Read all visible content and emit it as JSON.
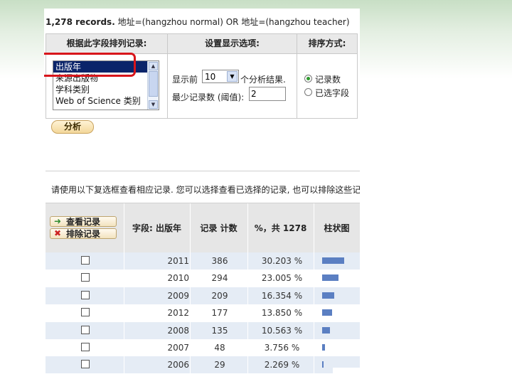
{
  "records_summary": {
    "count": "1,278 records.",
    "query": "地址=(hangzhou normal) OR 地址=(hangzhou teacher)"
  },
  "panel": {
    "col1_header": "根据此字段排列记录:",
    "col2_header": "设置显示选项:",
    "col3_header": "排序方式:",
    "field_list": [
      "出版年",
      "来源出版物",
      "学科类别",
      "Web of Science 类别"
    ],
    "selected_field": "出版年",
    "show_prefix": "显示前",
    "show_count": "10",
    "show_suffix": "个分析结果.",
    "min_records_label": "最少记录数 (阈值):",
    "min_records_value": "2",
    "sort_options": [
      "记录数",
      "已选字段"
    ],
    "sort_selected": "记录数"
  },
  "analyze_button": "分析",
  "info_text": "请使用以下复选框查看相应记录. 您可以选择查看已选择的记录, 也可以排除这些记",
  "results": {
    "view_records_button": "查看记录",
    "exclude_records_button": "排除记录",
    "headers": {
      "field": "字段: 出版年",
      "count": "记录 计数",
      "percent": "%，共 1278",
      "bar": "柱状图"
    },
    "rows": [
      {
        "year": "2011",
        "count": "386",
        "percent": "30.203 %",
        "share": 0.30203
      },
      {
        "year": "2010",
        "count": "294",
        "percent": "23.005 %",
        "share": 0.23005
      },
      {
        "year": "2009",
        "count": "209",
        "percent": "16.354 %",
        "share": 0.16354
      },
      {
        "year": "2012",
        "count": "177",
        "percent": "13.850 %",
        "share": 0.1385
      },
      {
        "year": "2008",
        "count": "135",
        "percent": "10.563 %",
        "share": 0.10563
      },
      {
        "year": "2007",
        "count": "48",
        "percent": "3.756 %",
        "share": 0.03756
      },
      {
        "year": "2006",
        "count": "29",
        "percent": "2.269 %",
        "share": 0.02269
      }
    ]
  },
  "colors": {
    "bar": "#5b7fc2",
    "highlight": "#d8151b",
    "row_alt": "#e5ecf5"
  }
}
